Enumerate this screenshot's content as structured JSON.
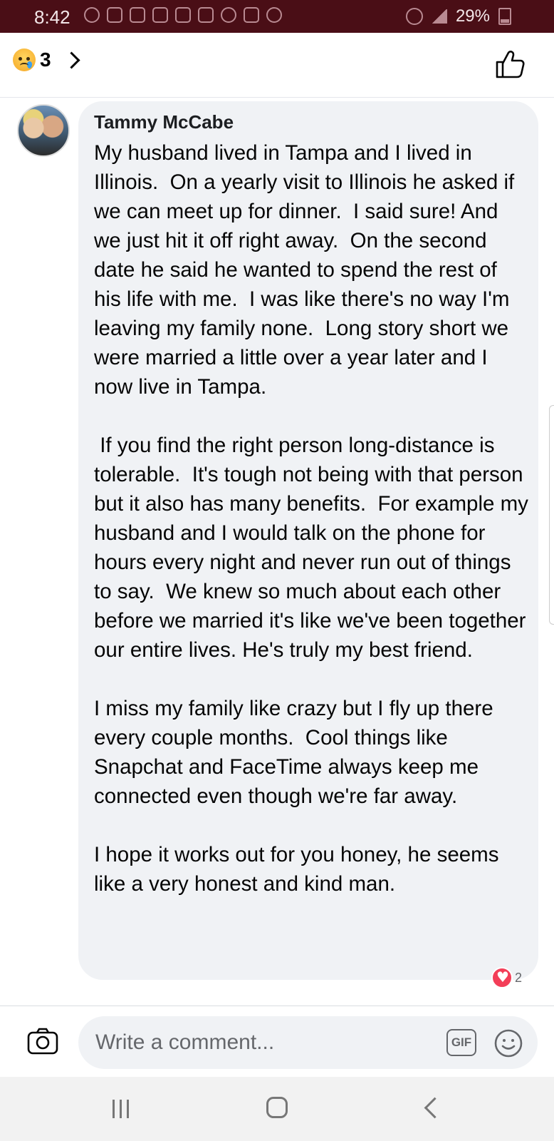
{
  "status_bar": {
    "time": "8:42",
    "battery": "29%"
  },
  "header": {
    "reaction_count": "3",
    "icons": [
      "sad-reaction-icon",
      "chevron-right-icon",
      "like-thumb-icon"
    ]
  },
  "comment": {
    "author": "Tammy McCabe",
    "text": "My husband lived in Tampa and I lived in Illinois.  On a yearly visit to Illinois he asked if we can meet up for dinner.  I said sure! And we just hit it off right away.  On the second date he said he wanted to spend the rest of his life with me.  I was like there's no way I'm leaving my family none.  Long story short we were married a little over a year later and I now live in Tampa.\n\n If you find the right person long-distance is tolerable.  It's tough not being with that person but it also has many benefits.  For example my husband and I would talk on the phone for hours every night and never run out of things to say.  We knew so much about each other before we married it's like we've been together our entire lives. He's truly my best friend.\n\nI miss my family like crazy but I fly up there every couple months.  Cool things like Snapchat and FaceTime always keep me connected even though we're far away.\n\nI hope it works out for you honey, he seems like a very honest and kind man.",
    "reaction_badge_count": "2"
  },
  "composer": {
    "placeholder": "Write a comment...",
    "gif_label": "GIF"
  },
  "colors": {
    "status_bar_bg": "#4a0e16",
    "bubble_bg": "#f0f2f5",
    "heart": "#f33e58"
  }
}
